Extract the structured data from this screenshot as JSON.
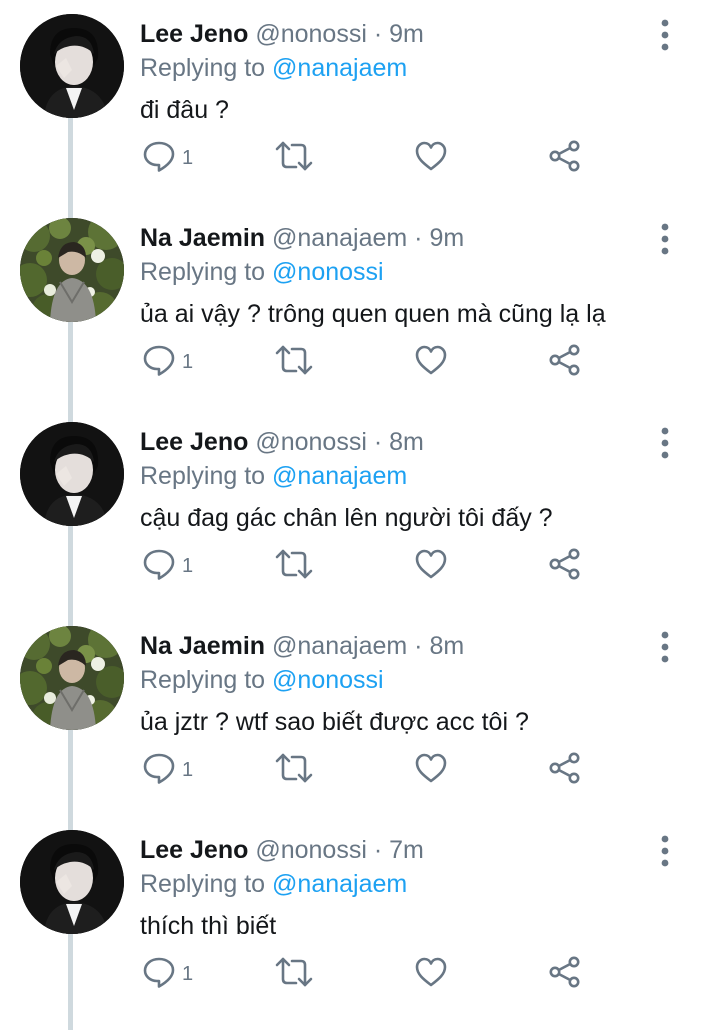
{
  "icons": {
    "reply": "comment-bubble-icon",
    "retweet": "retweet-icon",
    "like": "heart-icon",
    "share": "share-icon",
    "more": "more-vertical-icon"
  },
  "colors": {
    "link": "#1da1f2",
    "secondary": "#687684",
    "primary_text": "#14171a",
    "thread_line": "#cfd9de"
  },
  "reply_prefix": "Replying to",
  "tweets": [
    {
      "name": "Lee Jeno",
      "handle": "@nonossi",
      "dot": "·",
      "time": "9m",
      "reply_to": "@nanajaem",
      "text": "đi đâu ?",
      "reply_count": "1"
    },
    {
      "name": "Na Jaemin",
      "handle": "@nanajaem",
      "dot": "·",
      "time": "9m",
      "reply_to": "@nonossi",
      "text": "ủa ai vậy ? trông quen quen mà cũng lạ lạ",
      "reply_count": "1"
    },
    {
      "name": "Lee Jeno",
      "handle": "@nonossi",
      "dot": "·",
      "time": "8m",
      "reply_to": "@nanajaem",
      "text": "cậu đag gác chân lên người tôi đấy ?",
      "reply_count": "1"
    },
    {
      "name": "Na Jaemin",
      "handle": "@nanajaem",
      "dot": "·",
      "time": "8m",
      "reply_to": "@nonossi",
      "text": "ủa jztr ? wtf sao biết được acc tôi ?",
      "reply_count": "1"
    },
    {
      "name": "Lee Jeno",
      "handle": "@nonossi",
      "dot": "·",
      "time": "7m",
      "reply_to": "@nanajaem",
      "text": "thích thì biết",
      "reply_count": "1"
    }
  ]
}
